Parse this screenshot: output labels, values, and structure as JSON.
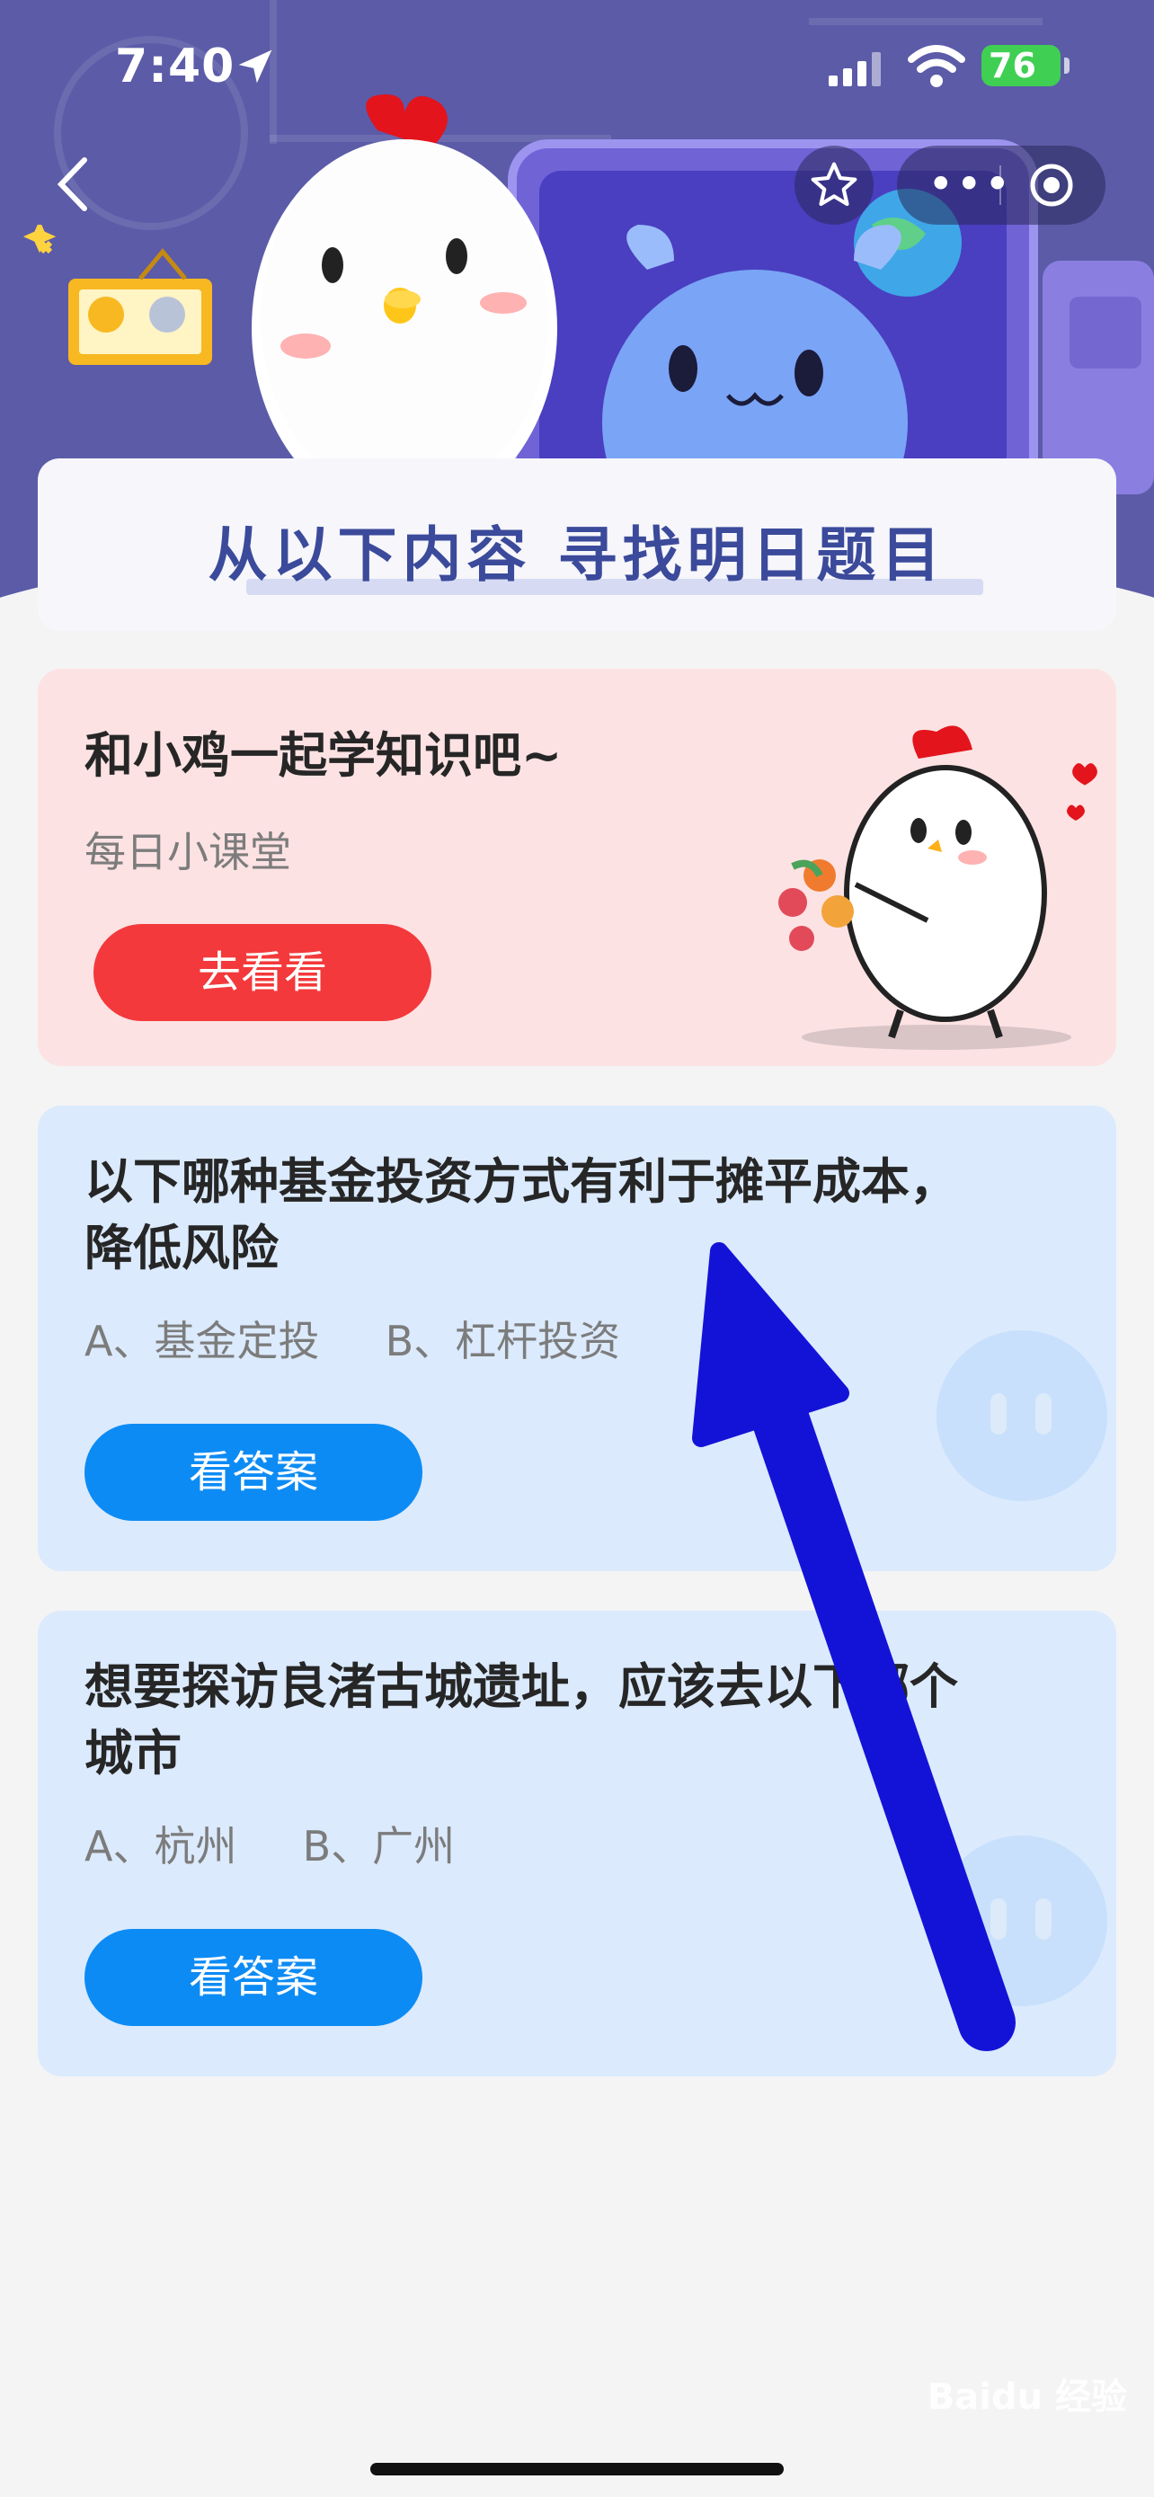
{
  "status": {
    "time": "7:40",
    "battery": "76"
  },
  "nav": {
    "back_icon": "chevron-left-icon",
    "star_icon": "star-outline-icon",
    "more_icon": "more-dots-icon",
    "target_icon": "target-icon"
  },
  "banner": {
    "title": "从以下内容  寻找明日题目"
  },
  "lesson_card": {
    "title": "和小鸡一起学知识吧~",
    "subtitle": "每日小课堂",
    "button_label": "去看看"
  },
  "questions": [
    {
      "question": "以下哪种基金投资方式有利于摊平成本，降低风险",
      "options": "A、基金定投     B、杠杆投资",
      "button_label": "看答案"
    },
    {
      "question": "想要探访良渚古城遗址，应该去以下哪个城市",
      "options": "A、杭州     B、广州",
      "button_label": "看答案"
    }
  ],
  "watermark": "Baidu 经验",
  "colors": {
    "header_bg": "#5b5ba8",
    "pink_card": "#fde2e3",
    "blue_card": "#dbeafd",
    "red_button": "#f3393b",
    "blue_button": "#0d8bf4",
    "arrow": "#1313d8"
  }
}
